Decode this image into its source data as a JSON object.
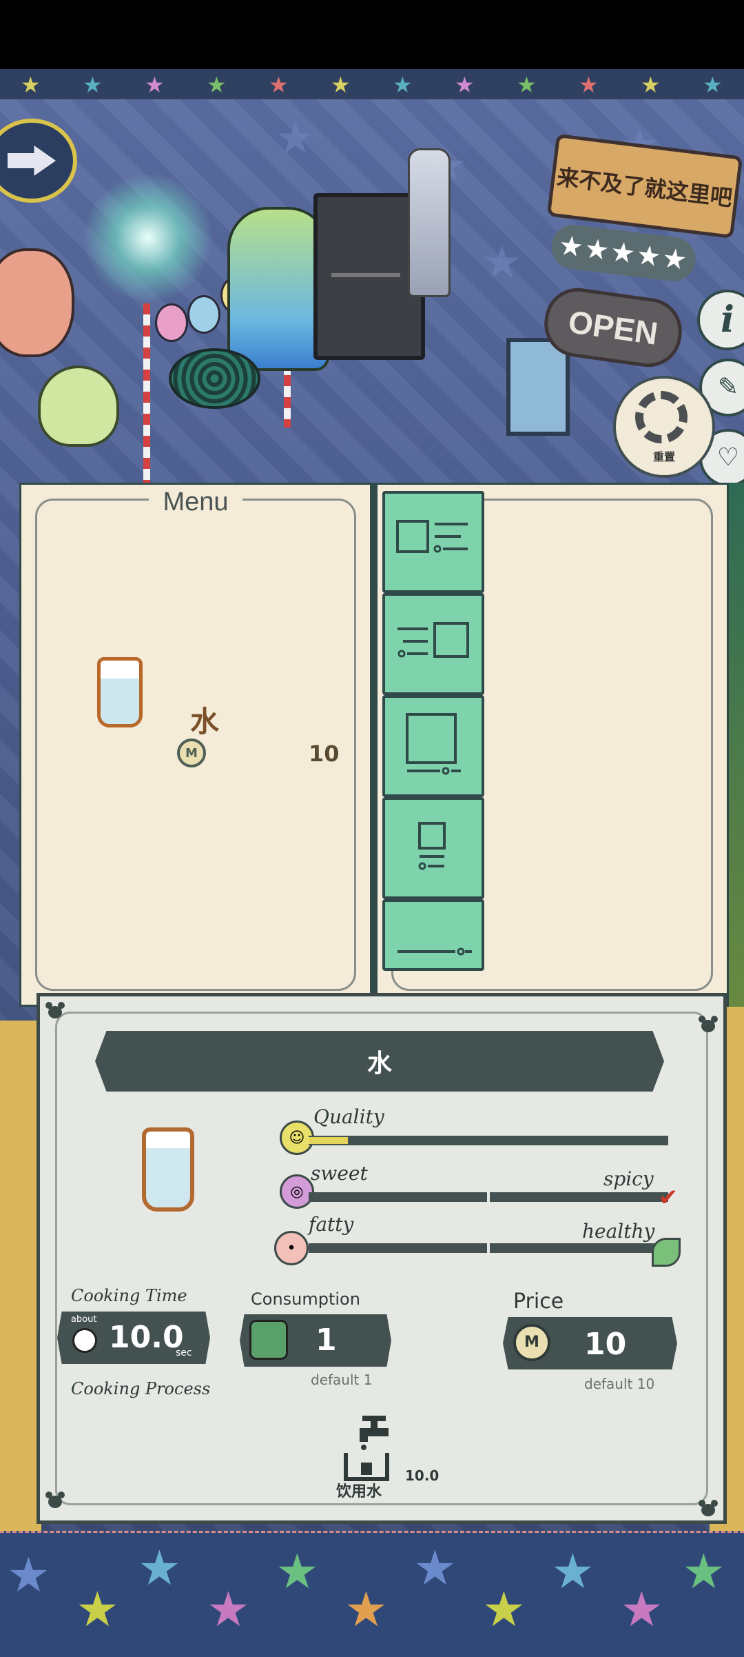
{
  "scene": {
    "sign_text": "来不及了就这里吧",
    "stars_text": "★★★★★",
    "open_text": "OPEN",
    "info_icon": "i",
    "reset_label": "重置"
  },
  "menu": {
    "title": "Menu",
    "items": [
      {
        "name": "水",
        "price": "10"
      }
    ],
    "category_tabs": [
      {
        "icon": "layout-square-lines-icon"
      },
      {
        "icon": "layout-lines-square-icon"
      },
      {
        "icon": "layout-big-square-icon"
      },
      {
        "icon": "layout-small-square-icon"
      },
      {
        "icon": "layout-line-icon"
      }
    ]
  },
  "detail": {
    "title": "水",
    "quality_label": "Quality",
    "quality_level": 0.11,
    "sweet_label": "sweet",
    "spicy_label": "spicy",
    "fatty_label": "fatty",
    "healthy_label": "healthy",
    "cooking_time_label": "Cooking Time",
    "about_label": "about",
    "cooking_time_value": "10.0",
    "sec_label": "sec",
    "consumption_label": "Consumption",
    "consumption_value": "1",
    "consumption_default": "default 1",
    "price_label": "Price",
    "price_value": "10",
    "price_default": "default 10",
    "cooking_process_label": "Cooking Process",
    "process_step": {
      "name": "饮用水",
      "time": "10.0"
    }
  }
}
